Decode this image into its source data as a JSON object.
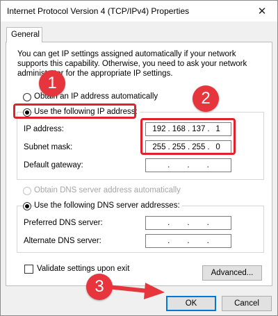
{
  "window": {
    "title": "Internet Protocol Version 4 (TCP/IPv4) Properties",
    "close_glyph": "✕"
  },
  "tabs": [
    {
      "label": "General"
    }
  ],
  "intro_text": "You can get IP settings assigned automatically if your network supports this capability. Otherwise, you need to ask your network administrator for the appropriate IP settings.",
  "ip_options": {
    "auto_label": "Obtain an IP address automatically",
    "manual_label": "Use the following IP address:",
    "selected": "manual"
  },
  "ip_fields": {
    "ip_address": {
      "label": "IP address:",
      "octets": [
        "192",
        "168",
        "137",
        "1"
      ]
    },
    "subnet_mask": {
      "label": "Subnet mask:",
      "octets": [
        "255",
        "255",
        "255",
        "0"
      ]
    },
    "default_gateway": {
      "label": "Default gateway:",
      "octets": [
        "",
        "",
        "",
        ""
      ]
    }
  },
  "dns_options": {
    "auto_label": "Obtain DNS server address automatically",
    "manual_label": "Use the following DNS server addresses:",
    "selected": "manual"
  },
  "dns_fields": {
    "preferred": {
      "label": "Preferred DNS server:",
      "octets": [
        "",
        "",
        "",
        ""
      ]
    },
    "alternate": {
      "label": "Alternate DNS server:",
      "octets": [
        "",
        "",
        "",
        ""
      ]
    }
  },
  "validate_label": "Validate settings upon exit",
  "validate_checked": false,
  "buttons": {
    "advanced": "Advanced...",
    "ok": "OK",
    "cancel": "Cancel"
  },
  "annotations": {
    "step1": "1",
    "step2": "2",
    "step3": "3",
    "highlight_color": "#e0202a"
  }
}
